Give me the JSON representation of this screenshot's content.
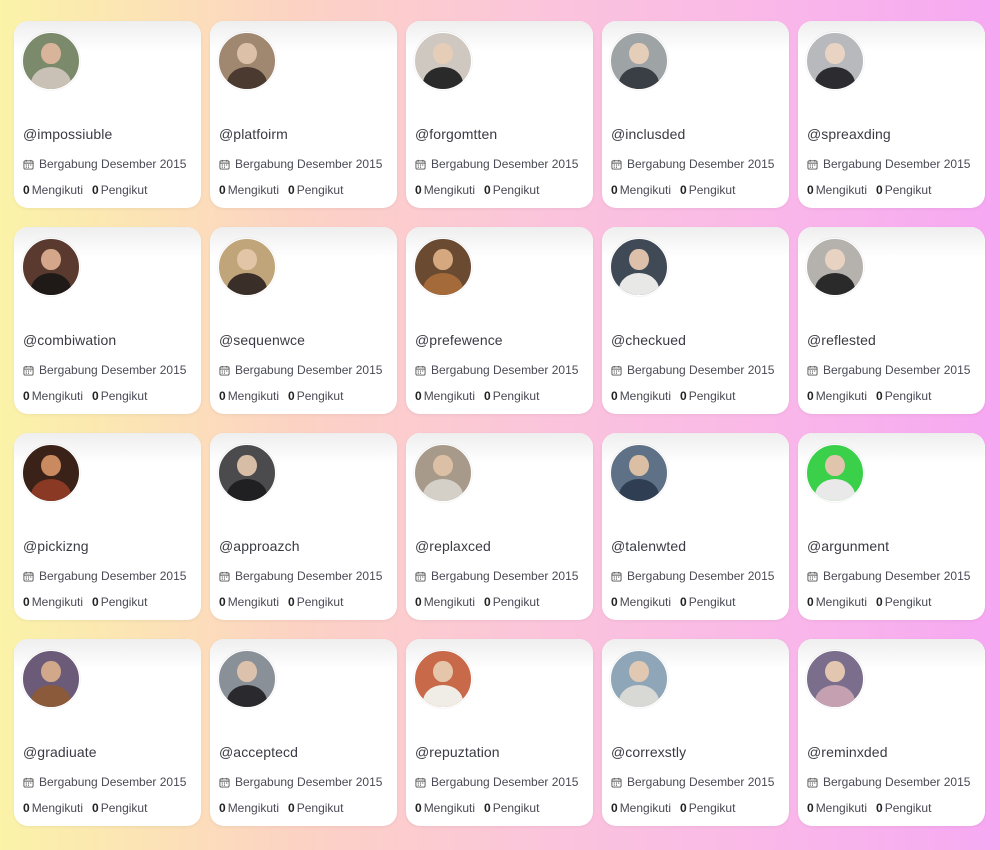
{
  "labels": {
    "joined": "Bergabung Desember 2015",
    "following": "Mengikuti",
    "followers": "Pengikut"
  },
  "users": [
    {
      "handle": "@impossiuble",
      "following": "0",
      "followers": "0",
      "avatar": {
        "bg": "#7b8a6a",
        "skin": "#d8b49a",
        "shirt": "#c9c1b5"
      }
    },
    {
      "handle": "@platfoirm",
      "following": "0",
      "followers": "0",
      "avatar": {
        "bg": "#a08770",
        "skin": "#dcc0a8",
        "shirt": "#4a3a30"
      }
    },
    {
      "handle": "@forgomtten",
      "following": "0",
      "followers": "0",
      "avatar": {
        "bg": "#cfc8c0",
        "skin": "#e6cdb8",
        "shirt": "#2a2a2a"
      }
    },
    {
      "handle": "@inclusded",
      "following": "0",
      "followers": "0",
      "avatar": {
        "bg": "#9ea3a6",
        "skin": "#e4cdb9",
        "shirt": "#3a3f46"
      }
    },
    {
      "handle": "@spreaxding",
      "following": "0",
      "followers": "0",
      "avatar": {
        "bg": "#b7b9bd",
        "skin": "#e9d3c2",
        "shirt": "#2c2c30"
      }
    },
    {
      "handle": "@combiwation",
      "following": "0",
      "followers": "0",
      "avatar": {
        "bg": "#5a3a2e",
        "skin": "#d4a78a",
        "shirt": "#1f1a18"
      }
    },
    {
      "handle": "@sequenwce",
      "following": "0",
      "followers": "0",
      "avatar": {
        "bg": "#c0a57a",
        "skin": "#e2c4a6",
        "shirt": "#3a2e28"
      }
    },
    {
      "handle": "@prefewence",
      "following": "0",
      "followers": "0",
      "avatar": {
        "bg": "#6b4a32",
        "skin": "#d6a880",
        "shirt": "#a46a3a"
      }
    },
    {
      "handle": "@checkued",
      "following": "0",
      "followers": "0",
      "avatar": {
        "bg": "#3f4a56",
        "skin": "#dcc0aa",
        "shirt": "#e8e8e6"
      }
    },
    {
      "handle": "@reflested",
      "following": "0",
      "followers": "0",
      "avatar": {
        "bg": "#b5b2ad",
        "skin": "#e8d2c2",
        "shirt": "#2a2a2a"
      }
    },
    {
      "handle": "@pickizng",
      "following": "0",
      "followers": "0",
      "avatar": {
        "bg": "#3a2218",
        "skin": "#c98a60",
        "shirt": "#8a3a24"
      }
    },
    {
      "handle": "@approazch",
      "following": "0",
      "followers": "0",
      "avatar": {
        "bg": "#4b4b4e",
        "skin": "#d8bda6",
        "shirt": "#202022"
      }
    },
    {
      "handle": "@replaxced",
      "following": "0",
      "followers": "0",
      "avatar": {
        "bg": "#a89a8a",
        "skin": "#dcc0a6",
        "shirt": "#d4d0c8"
      }
    },
    {
      "handle": "@talenwted",
      "following": "0",
      "followers": "0",
      "avatar": {
        "bg": "#5e7186",
        "skin": "#dbbfa4",
        "shirt": "#2f3e52"
      }
    },
    {
      "handle": "@argunment",
      "following": "0",
      "followers": "0",
      "avatar": {
        "bg": "#3bd04a",
        "skin": "#e0c4ac",
        "shirt": "#e9e9e9"
      }
    },
    {
      "handle": "@gradiuate",
      "following": "0",
      "followers": "0",
      "avatar": {
        "bg": "#6b5a78",
        "skin": "#d2a88a",
        "shirt": "#8a5a3a"
      }
    },
    {
      "handle": "@acceptecd",
      "following": "0",
      "followers": "0",
      "avatar": {
        "bg": "#8a9098",
        "skin": "#dcc2ac",
        "shirt": "#2a2a2e"
      }
    },
    {
      "handle": "@repuztation",
      "following": "0",
      "followers": "0",
      "avatar": {
        "bg": "#c8694a",
        "skin": "#e6c6aa",
        "shirt": "#f0ece6"
      }
    },
    {
      "handle": "@correxstly",
      "following": "0",
      "followers": "0",
      "avatar": {
        "bg": "#8fa6b8",
        "skin": "#e0c8b2",
        "shirt": "#d8d8d4"
      }
    },
    {
      "handle": "@reminxded",
      "following": "0",
      "followers": "0",
      "avatar": {
        "bg": "#7a6e8c",
        "skin": "#e2c6b0",
        "shirt": "#c4a0b0"
      }
    }
  ],
  "colors": {
    "card_bg": "#ffffff",
    "text": "#3a3a44",
    "gradient_left": "#fbf3a8",
    "gradient_right": "#f6a8f2"
  }
}
